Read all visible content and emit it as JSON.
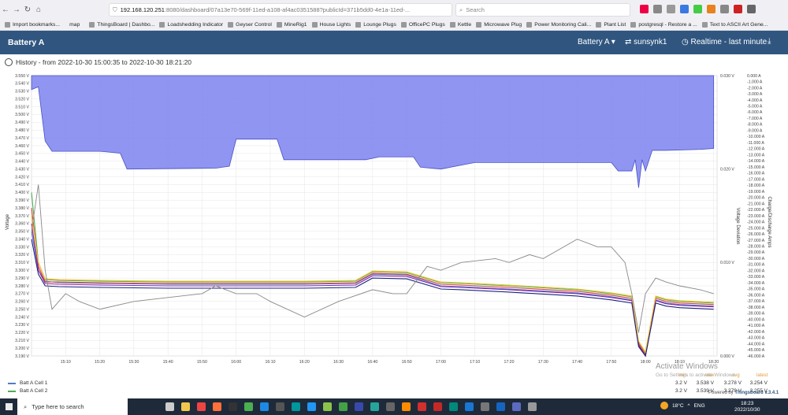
{
  "browser": {
    "url_host": "192.168.120.251",
    "url_path": ":8080/dashboard/07a13e70-569f-11ed-a108-af4ac0351588?publicId=371b5dd0-4e1a-11ed-...",
    "search_placeholder": "Search"
  },
  "bookmarks": [
    "Import bookmarks...",
    "map",
    "ThingsBoard | Dashbo...",
    "Loadshedding Indicator",
    "Geyser Control",
    "MineRig1",
    "House Lights",
    "Lounge Plugs",
    "OfficePC Plugs",
    "Kettle",
    "Microwave Plug",
    "Power Monitoring Cali...",
    "Plant List",
    "postgresql - Restore a ...",
    "Text to ASCII Art Gene..."
  ],
  "header": {
    "title": "Battery A",
    "entity_select": "Battery A ▾",
    "device": "sunsynk1",
    "timewindow": "Realtime - last minute"
  },
  "history_label": "History - from 2022-10-30 15:00:35 to 2022-10-30 18:21:20",
  "colors": {
    "header_bg": "#305680",
    "deviation_fill": "#7b83ee",
    "cell1": "#4e7fc4",
    "cell2": "#4caf50"
  },
  "chart_data": {
    "type": "line",
    "y_left": {
      "label": "Voltage",
      "ticks": [
        "3.550 V",
        "3.540 V",
        "3.530 V",
        "3.520 V",
        "3.510 V",
        "3.500 V",
        "3.490 V",
        "3.480 V",
        "3.470 V",
        "3.460 V",
        "3.450 V",
        "3.440 V",
        "3.430 V",
        "3.420 V",
        "3.410 V",
        "3.400 V",
        "3.390 V",
        "3.380 V",
        "3.370 V",
        "3.360 V",
        "3.350 V",
        "3.340 V",
        "3.330 V",
        "3.320 V",
        "3.310 V",
        "3.300 V",
        "3.290 V",
        "3.280 V",
        "3.270 V",
        "3.260 V",
        "3.250 V",
        "3.240 V",
        "3.230 V",
        "3.220 V",
        "3.210 V",
        "3.200 V",
        "3.190 V"
      ],
      "range": [
        3.19,
        3.55
      ]
    },
    "y_mid": {
      "label": "Voltage Deviation",
      "ticks": [
        "0.030 V",
        "0.020 V",
        "0.010 V",
        "0.000 V"
      ],
      "range": [
        0,
        0.03
      ]
    },
    "y_right": {
      "label": "Charge/Discharge Amps",
      "ticks": [
        "0.000 A",
        "-1.000 A",
        "-2.000 A",
        "-3.000 A",
        "-4.000 A",
        "-5.000 A",
        "-6.000 A",
        "-7.000 A",
        "-8.000 A",
        "-9.000 A",
        "-10.000 A",
        "-11.000 A",
        "-12.000 A",
        "-13.000 A",
        "-14.000 A",
        "-15.000 A",
        "-16.000 A",
        "-17.000 A",
        "-18.000 A",
        "-19.000 A",
        "-20.000 A",
        "-21.000 A",
        "-22.000 A",
        "-23.000 A",
        "-24.000 A",
        "-25.000 A",
        "-26.000 A",
        "-27.000 A",
        "-28.000 A",
        "-29.000 A",
        "-30.000 A",
        "-31.000 A",
        "-32.000 A",
        "-33.000 A",
        "-34.000 A",
        "-35.000 A",
        "-36.000 A",
        "-37.000 A",
        "-38.000 A",
        "-39.000 A",
        "-40.000 A",
        "-41.000 A",
        "-42.000 A",
        "-43.000 A",
        "-44.000 A",
        "-45.000 A",
        "-46.000 A"
      ],
      "range": [
        -46,
        0
      ]
    },
    "x_ticks": [
      "15:10",
      "15:20",
      "15:30",
      "15:40",
      "15:50",
      "16:00",
      "16:10",
      "16:20",
      "16:30",
      "16:40",
      "16:50",
      "17:00",
      "17:10",
      "17:20",
      "17:30",
      "17:40",
      "17:50",
      "18:00",
      "18:10",
      "18:20"
    ],
    "x_range_min": [
      0,
      201
    ],
    "grid": true,
    "series": [
      {
        "name": "Batt A Cell 1",
        "color": "#4e7fc4",
        "t": [
          0,
          2,
          4,
          8,
          20,
          40,
          60,
          80,
          95,
          100,
          110,
          120,
          126,
          140,
          160,
          170,
          176,
          178,
          180,
          183,
          186,
          190,
          200
        ],
        "v": [
          3.35,
          3.3,
          3.286,
          3.284,
          3.283,
          3.282,
          3.282,
          3.282,
          3.283,
          3.295,
          3.294,
          3.28,
          3.279,
          3.276,
          3.271,
          3.266,
          3.262,
          3.205,
          3.19,
          3.262,
          3.258,
          3.256,
          3.254
        ]
      },
      {
        "name": "Batt A Cell 2",
        "color": "#4caf50",
        "t": [
          0,
          2,
          4,
          8,
          20,
          40,
          60,
          80,
          95,
          100,
          110,
          120,
          126,
          140,
          160,
          170,
          176,
          178,
          180,
          183,
          186,
          190,
          200
        ],
        "v": [
          3.4,
          3.31,
          3.288,
          3.287,
          3.286,
          3.285,
          3.285,
          3.285,
          3.286,
          3.298,
          3.297,
          3.284,
          3.283,
          3.28,
          3.275,
          3.27,
          3.266,
          3.208,
          3.194,
          3.266,
          3.262,
          3.26,
          3.258
        ]
      },
      {
        "name": "",
        "color": "#e53935",
        "t": [
          0,
          2,
          4,
          8,
          20,
          40,
          60,
          80,
          95,
          100,
          110,
          120,
          126,
          140,
          160,
          170,
          176,
          178,
          180,
          183,
          186,
          190,
          200
        ],
        "v": [
          3.38,
          3.305,
          3.285,
          3.285,
          3.284,
          3.283,
          3.283,
          3.283,
          3.284,
          3.296,
          3.295,
          3.282,
          3.281,
          3.278,
          3.273,
          3.268,
          3.264,
          3.206,
          3.192,
          3.264,
          3.26,
          3.258,
          3.256
        ]
      },
      {
        "name": "",
        "color": "#8e24aa",
        "t": [
          0,
          2,
          4,
          8,
          20,
          40,
          60,
          80,
          95,
          100,
          110,
          120,
          126,
          140,
          160,
          170,
          176,
          178,
          180,
          183,
          186,
          190,
          200
        ],
        "v": [
          3.36,
          3.3,
          3.283,
          3.282,
          3.281,
          3.28,
          3.28,
          3.28,
          3.281,
          3.293,
          3.292,
          3.279,
          3.278,
          3.275,
          3.27,
          3.265,
          3.261,
          3.204,
          3.19,
          3.261,
          3.257,
          3.255,
          3.253
        ]
      },
      {
        "name": "",
        "color": "#fbc02d",
        "t": [
          0,
          2,
          4,
          8,
          20,
          40,
          60,
          80,
          95,
          100,
          110,
          120,
          126,
          140,
          160,
          170,
          176,
          178,
          180,
          183,
          186,
          190,
          200
        ],
        "v": [
          3.37,
          3.31,
          3.289,
          3.288,
          3.287,
          3.286,
          3.286,
          3.286,
          3.287,
          3.299,
          3.298,
          3.285,
          3.284,
          3.281,
          3.276,
          3.271,
          3.267,
          3.209,
          3.195,
          3.267,
          3.263,
          3.261,
          3.259
        ]
      },
      {
        "name": "",
        "color": "#1a237e",
        "t": [
          0,
          2,
          4,
          8,
          20,
          40,
          60,
          80,
          95,
          100,
          110,
          120,
          126,
          140,
          160,
          170,
          176,
          178,
          180,
          183,
          186,
          190,
          200
        ],
        "v": [
          3.34,
          3.295,
          3.28,
          3.279,
          3.278,
          3.277,
          3.277,
          3.277,
          3.278,
          3.29,
          3.289,
          3.276,
          3.275,
          3.272,
          3.267,
          3.262,
          3.258,
          3.202,
          3.19,
          3.258,
          3.254,
          3.252,
          3.25
        ]
      },
      {
        "name": "",
        "color": "#888888",
        "t": [
          0,
          2,
          4,
          6,
          8,
          10,
          14,
          20,
          30,
          40,
          50,
          54,
          60,
          66,
          70,
          80,
          90,
          100,
          106,
          110,
          116,
          120,
          126,
          136,
          140,
          146,
          150,
          160,
          166,
          170,
          174,
          176,
          178,
          180,
          183,
          186,
          190,
          196,
          200
        ],
        "v": [
          3.35,
          3.41,
          3.3,
          3.25,
          3.26,
          3.27,
          3.26,
          3.25,
          3.26,
          3.265,
          3.27,
          3.28,
          3.27,
          3.27,
          3.26,
          3.24,
          3.26,
          3.275,
          3.27,
          3.27,
          3.305,
          3.3,
          3.31,
          3.315,
          3.31,
          3.32,
          3.315,
          3.34,
          3.33,
          3.33,
          3.31,
          3.27,
          3.22,
          3.27,
          3.29,
          3.285,
          3.28,
          3.275,
          3.27
        ]
      }
    ],
    "deviation": {
      "name": "Voltage Deviation",
      "color": "#7b83ee",
      "t": [
        0,
        2,
        4,
        6,
        20,
        26,
        28,
        54,
        58,
        60,
        66,
        72,
        74,
        96,
        98,
        102,
        112,
        114,
        120,
        130,
        134,
        170,
        172,
        176,
        177,
        178,
        179,
        180,
        182,
        186,
        196,
        200
      ],
      "v": [
        0.0285,
        0.0288,
        0.023,
        0.0219,
        0.0219,
        0.0217,
        0.02,
        0.0201,
        0.0203,
        0.0232,
        0.0232,
        0.0232,
        0.021,
        0.021,
        0.021,
        0.0213,
        0.0213,
        0.0202,
        0.02,
        0.0207,
        0.0207,
        0.0207,
        0.0198,
        0.0198,
        0.021,
        0.018,
        0.021,
        0.0198,
        0.022,
        0.022,
        0.0221,
        0.0222
      ]
    }
  },
  "legend": {
    "headers": {
      "min": "min",
      "max": "max",
      "avg": "avg",
      "latest": "latest"
    },
    "rows": [
      {
        "name": "Batt A Cell 1",
        "min": "3.2 V",
        "max": "3.538 V",
        "avg": "3.278 V",
        "latest": "3.254 V"
      },
      {
        "name": "Batt A Cell 2",
        "min": "3.2 V",
        "max": "3.539 V",
        "avg": "3.279 V",
        "latest": "3.255 V"
      }
    ]
  },
  "watermark": {
    "line1": "Activate Windows",
    "line2": "Go to Settings to activate Windows."
  },
  "powered_by": {
    "text": "Powered by ",
    "brand": "Thingsboard v.3.4.1"
  },
  "taskbar": {
    "search_placeholder": "Type here to search",
    "temperature": "18°C",
    "lang": "ENG",
    "time": "18:23",
    "date": "2022/10/30"
  }
}
